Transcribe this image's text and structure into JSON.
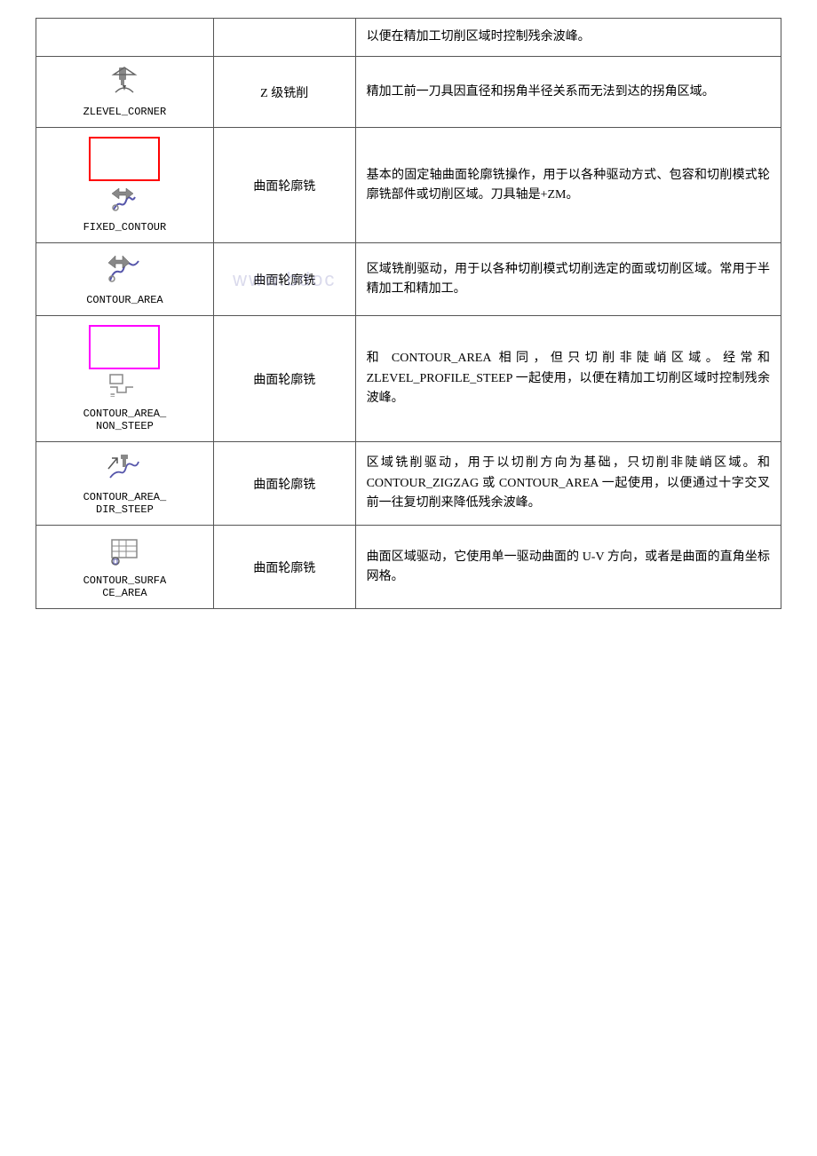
{
  "rows": [
    {
      "id": "row-intro",
      "icon_label": "",
      "icon_type": "none",
      "col_name": "",
      "description": "以便在精加工切削区域时控制残余波峰。"
    },
    {
      "id": "row-zlevel-corner",
      "icon_label": "ZLEVEL_CORNER",
      "icon_type": "zlevel_corner",
      "col_name": "Z 级铣削",
      "description": "精加工前一刀具因直径和拐角半径关系而无法到达的拐角区域。"
    },
    {
      "id": "row-fixed-contour",
      "icon_label": "FIXED_CONTOUR",
      "icon_type": "fixed_contour",
      "col_name": "曲面轮廓铣",
      "description": "基本的固定轴曲面轮廓铣操作，用于以各种驱动方式、包容和切削模式轮廓铣部件或切削区域。刀具轴是+ZM。"
    },
    {
      "id": "row-contour-area",
      "icon_label": "CONTOUR_AREA",
      "icon_type": "contour_area",
      "col_name": "曲面轮廓铣",
      "description": "区域铣削驱动，用于以各种切削模式切削选定的面或切削区域。常用于半精加工和精加工。"
    },
    {
      "id": "row-contour-area-non-steep",
      "icon_label": "CONTOUR_AREA_\nNON_STEEP",
      "icon_type": "contour_area_non_steep",
      "col_name": "曲面轮廓铣",
      "description": "和 CONTOUR_AREA 相同，但只切削非陡峭区域。经常和 ZLEVEL_PROFILE_STEEP 一起使用，以便在精加工切削区域时控制残余波峰。"
    },
    {
      "id": "row-contour-area-dir-steep",
      "icon_label": "CONTOUR_AREA_\nDIR_STEEP",
      "icon_type": "contour_area_dir_steep",
      "col_name": "曲面轮廓铣",
      "description": "区域铣削驱动，用于以切削方向为基础，只切削非陡峭区域。和 CONTOUR_ZIGZAG 或 CONTOUR_AREA 一起使用，以便通过十字交叉前一往复切削来降低残余波峰。"
    },
    {
      "id": "row-contour-surface-area",
      "icon_label": "CONTOUR_SURFA\nCE_AREA",
      "icon_type": "contour_surface_area",
      "col_name": "曲面轮廓铣",
      "description": "曲面区域驱动，它使用单一驱动曲面的 U-V 方向，或者是曲面的直角坐标网格。"
    }
  ],
  "watermark": "www.bdoc"
}
